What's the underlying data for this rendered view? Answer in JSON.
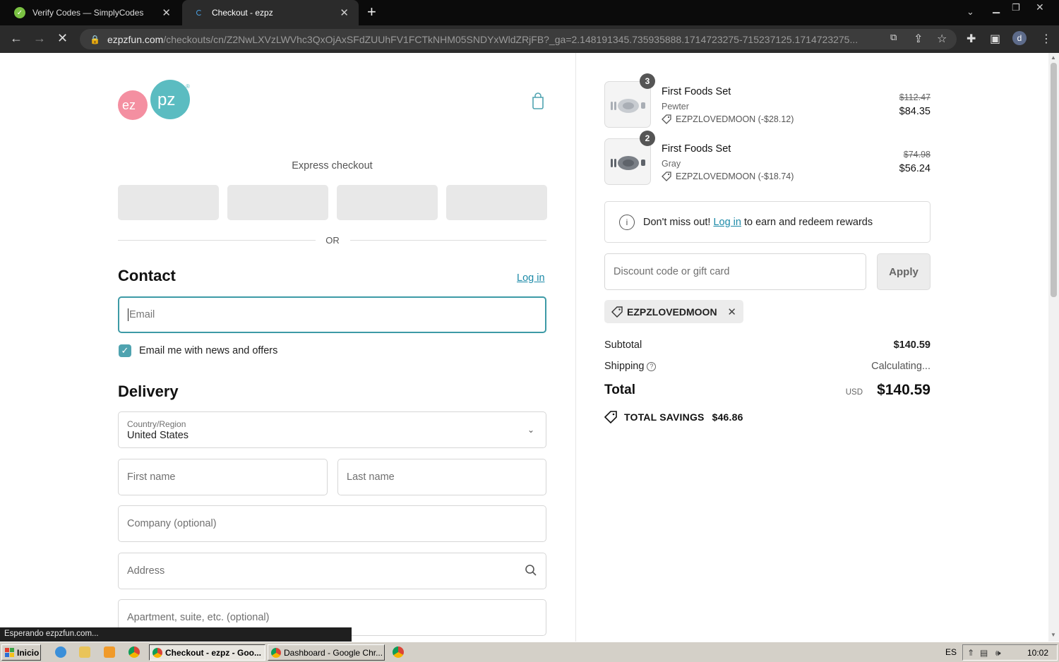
{
  "browser": {
    "tabs": [
      {
        "title": "Verify Codes — SimplyCodes",
        "active": false
      },
      {
        "title": "Checkout - ezpz",
        "active": true
      }
    ],
    "url_host": "ezpzfun.com",
    "url_path": "/checkouts/cn/Z2NwLXVzLWVhc3QxOjAxSFdZUUhFV1FCTkNHM05SNDYxWldZRjFB?_ga=2.148191345.735935888.1714723275-715237125.1714723275...",
    "profile_initial": "d",
    "status_text": "Esperando ezpzfun.com..."
  },
  "brand": {
    "logo_left": "ez",
    "logo_right": "pz",
    "registered": "®"
  },
  "express": {
    "label": "Express checkout",
    "or_text": "OR"
  },
  "contact": {
    "heading": "Contact",
    "login_link": "Log in",
    "email_placeholder": "Email",
    "email_value": "",
    "news_checkbox_label": "Email me with news and offers",
    "news_checked": true
  },
  "delivery": {
    "heading": "Delivery",
    "country_label": "Country/Region",
    "country_value": "United States",
    "first_name_placeholder": "First name",
    "last_name_placeholder": "Last name",
    "company_placeholder": "Company (optional)",
    "address_placeholder": "Address",
    "apartment_placeholder": "Apartment, suite, etc. (optional)"
  },
  "order": {
    "items": [
      {
        "qty": "3",
        "title": "First Foods Set",
        "variant": "Pewter",
        "discount": "EZPZLOVEDMOON (-$28.12)",
        "original_price": "$112.47",
        "price": "$84.35"
      },
      {
        "qty": "2",
        "title": "First Foods Set",
        "variant": "Gray",
        "discount": "EZPZLOVEDMOON (-$18.74)",
        "original_price": "$74.98",
        "price": "$56.24"
      }
    ],
    "rewards_prefix": "Don't miss out!",
    "rewards_link": "Log in",
    "rewards_suffix": "to earn and redeem rewards",
    "discount_placeholder": "Discount code or gift card",
    "apply_label": "Apply",
    "applied_code": "EZPZLOVEDMOON",
    "subtotal_label": "Subtotal",
    "subtotal_value": "$140.59",
    "shipping_label": "Shipping",
    "shipping_value": "Calculating...",
    "total_label": "Total",
    "currency": "USD",
    "total_value": "$140.59",
    "savings_label": "TOTAL SAVINGS",
    "savings_value": "$46.86"
  },
  "taskbar": {
    "start_label": "Inicio",
    "windows": [
      {
        "title": "Checkout - ezpz - Goo...",
        "active": true
      },
      {
        "title": "Dashboard - Google Chr...",
        "active": false
      }
    ],
    "language": "ES",
    "clock": "10:02"
  },
  "colors": {
    "accent": "#3d9aa6",
    "link": "#1c8aa8",
    "logo_pink": "#f48fa1",
    "logo_teal": "#5bbcc1"
  }
}
